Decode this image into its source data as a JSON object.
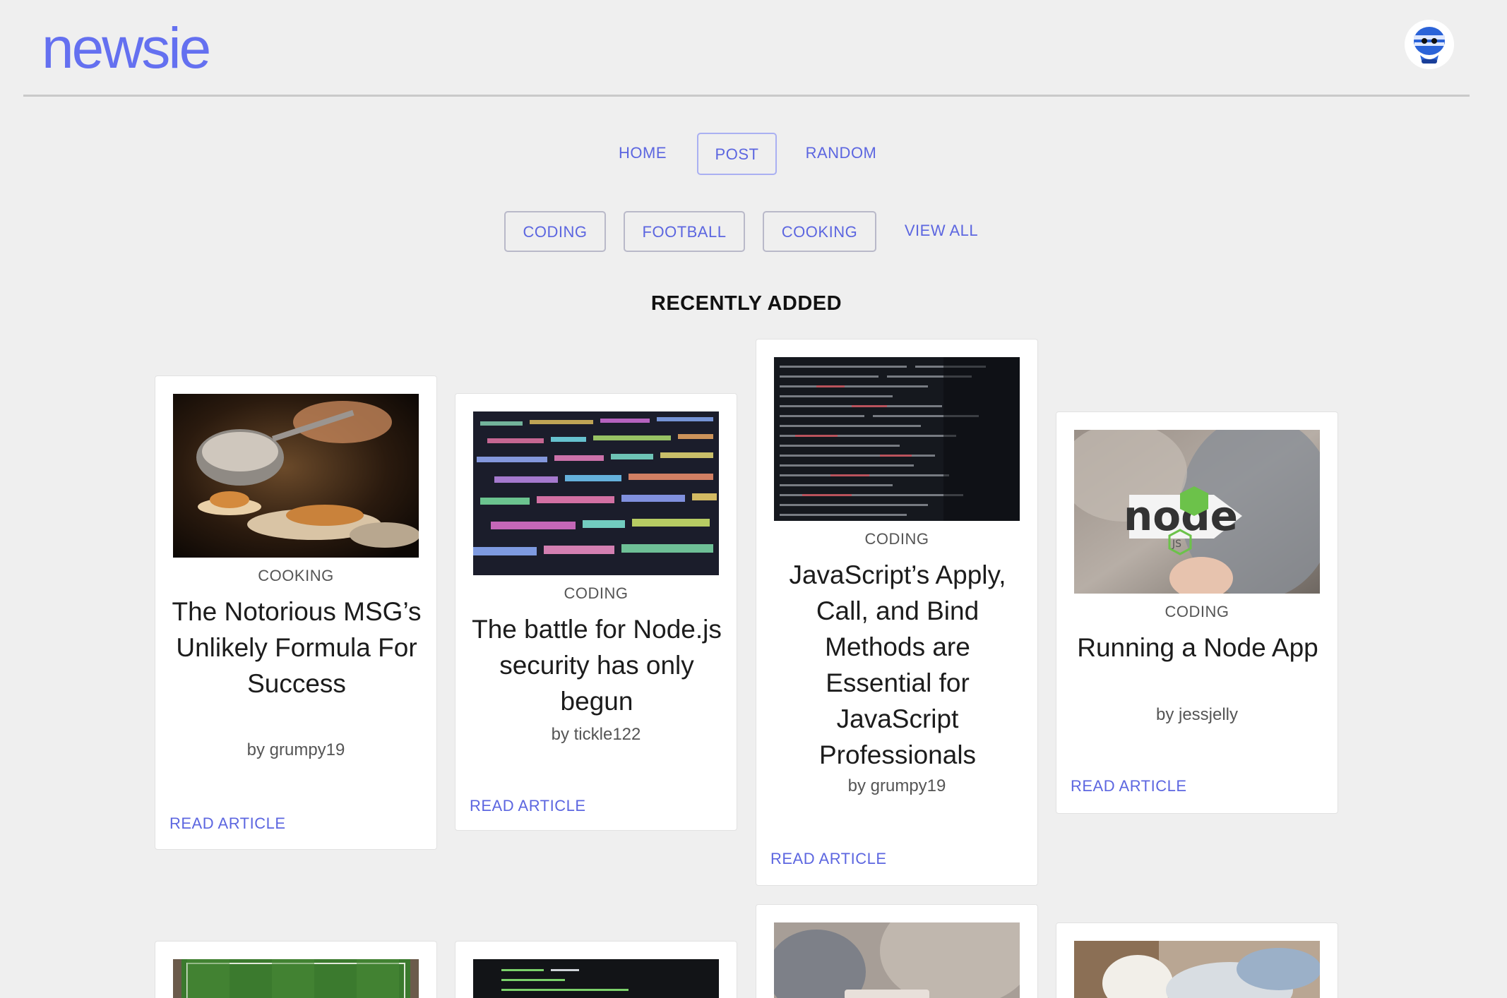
{
  "app": {
    "logo": "newsie"
  },
  "nav": {
    "items": [
      "HOME",
      "POST",
      "RANDOM"
    ]
  },
  "topics": {
    "items": [
      "CODING",
      "FOOTBALL",
      "COOKING",
      "VIEW ALL"
    ]
  },
  "section": {
    "title": "RECENTLY ADDED"
  },
  "articles": [
    {
      "topic": "COOKING",
      "title": "The Notorious MSG’s Unlikely Formula For Success",
      "author": "by grumpy19",
      "read": "READ ARTICLE",
      "image": "cooking-pan"
    },
    {
      "topic": "CODING",
      "title": "The battle for Node.js security has only begun",
      "author": "by tickle122",
      "read": "READ ARTICLE",
      "image": "code-screen"
    },
    {
      "topic": "CODING",
      "title": "JavaScript’s Apply, Call, and Bind Methods are Essential for JavaScript Professionals",
      "author": "by grumpy19",
      "read": "READ ARTICLE",
      "image": "code-dark"
    },
    {
      "topic": "CODING",
      "title": "Running a Node App",
      "author": "by jessjelly",
      "read": "READ ARTICLE",
      "image": "node-sticker"
    }
  ],
  "colors": {
    "accent": "#6470f0",
    "background": "#efefef"
  }
}
